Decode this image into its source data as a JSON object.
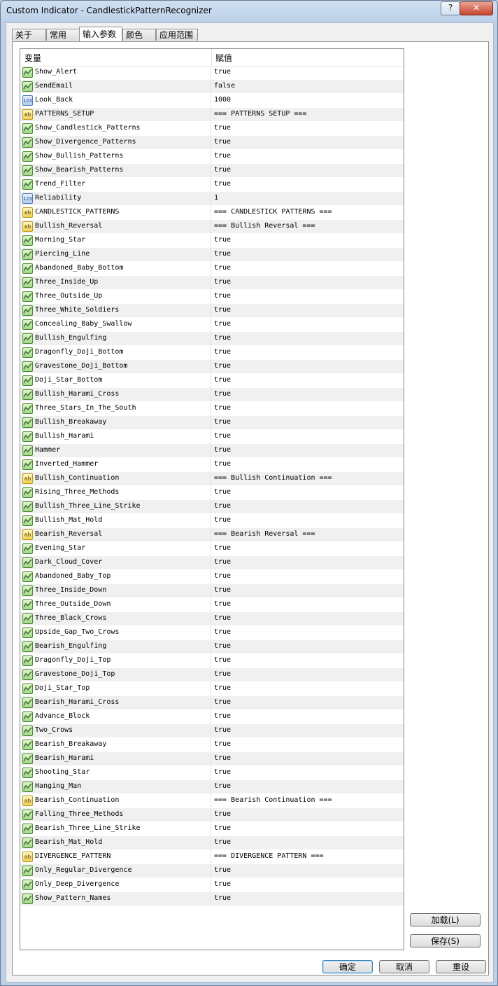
{
  "window": {
    "title": "Custom Indicator - CandlestickPatternRecognizer",
    "help_label": "?",
    "close_label": "✕"
  },
  "tabs": [
    "关于",
    "常用",
    "输入参数",
    "颜色",
    "应用范围"
  ],
  "active_tab": "输入参数",
  "table": {
    "header_variable": "变量",
    "header_value": "赋值",
    "rows": [
      {
        "type": "bool",
        "name": "Show_Alert",
        "value": "true"
      },
      {
        "type": "bool",
        "name": "SendEmail",
        "value": "false"
      },
      {
        "type": "int",
        "name": "Look_Back",
        "value": "1000"
      },
      {
        "type": "str",
        "name": "PATTERNS_SETUP",
        "value": "=== PATTERNS SETUP ==="
      },
      {
        "type": "bool",
        "name": "Show_Candlestick_Patterns",
        "value": "true"
      },
      {
        "type": "bool",
        "name": "Show_Divergence_Patterns",
        "value": "true"
      },
      {
        "type": "bool",
        "name": "Show_Bullish_Patterns",
        "value": "true"
      },
      {
        "type": "bool",
        "name": "Show_Bearish_Patterns",
        "value": "true"
      },
      {
        "type": "bool",
        "name": "Trend_Filter",
        "value": "true"
      },
      {
        "type": "int",
        "name": "Reliability",
        "value": "1"
      },
      {
        "type": "str",
        "name": "CANDLESTICK_PATTERNS",
        "value": "=== CANDLESTICK PATTERNS ==="
      },
      {
        "type": "str",
        "name": "Bullish_Reversal",
        "value": "=== Bullish Reversal ==="
      },
      {
        "type": "bool",
        "name": "Morning_Star",
        "value": "true"
      },
      {
        "type": "bool",
        "name": "Piercing_Line",
        "value": "true"
      },
      {
        "type": "bool",
        "name": "Abandoned_Baby_Bottom",
        "value": "true"
      },
      {
        "type": "bool",
        "name": "Three_Inside_Up",
        "value": "true"
      },
      {
        "type": "bool",
        "name": "Three_Outside_Up",
        "value": "true"
      },
      {
        "type": "bool",
        "name": "Three_White_Soldiers",
        "value": "true"
      },
      {
        "type": "bool",
        "name": "Concealing_Baby_Swallow",
        "value": "true"
      },
      {
        "type": "bool",
        "name": "Bullish_Engulfing",
        "value": "true"
      },
      {
        "type": "bool",
        "name": "Dragonfly_Doji_Bottom",
        "value": "true"
      },
      {
        "type": "bool",
        "name": "Gravestone_Doji_Bottom",
        "value": "true"
      },
      {
        "type": "bool",
        "name": "Doji_Star_Bottom",
        "value": "true"
      },
      {
        "type": "bool",
        "name": "Bullish_Harami_Cross",
        "value": "true"
      },
      {
        "type": "bool",
        "name": "Three_Stars_In_The_South",
        "value": "true"
      },
      {
        "type": "bool",
        "name": "Bullish_Breakaway",
        "value": "true"
      },
      {
        "type": "bool",
        "name": "Bullish_Harami",
        "value": "true"
      },
      {
        "type": "bool",
        "name": "Hammer",
        "value": "true"
      },
      {
        "type": "bool",
        "name": "Inverted_Hammer",
        "value": "true"
      },
      {
        "type": "str",
        "name": "Bullish_Continuation",
        "value": "=== Bullish Continuation ==="
      },
      {
        "type": "bool",
        "name": "Rising_Three_Methods",
        "value": "true"
      },
      {
        "type": "bool",
        "name": "Bullish_Three_Line_Strike",
        "value": "true"
      },
      {
        "type": "bool",
        "name": "Bullish_Mat_Hold",
        "value": "true"
      },
      {
        "type": "str",
        "name": "Bearish_Reversal",
        "value": "=== Bearish Reversal ==="
      },
      {
        "type": "bool",
        "name": "Evening_Star",
        "value": "true"
      },
      {
        "type": "bool",
        "name": "Dark_Cloud_Cover",
        "value": "true"
      },
      {
        "type": "bool",
        "name": "Abandoned_Baby_Top",
        "value": "true"
      },
      {
        "type": "bool",
        "name": "Three_Inside_Down",
        "value": "true"
      },
      {
        "type": "bool",
        "name": "Three_Outside_Down",
        "value": "true"
      },
      {
        "type": "bool",
        "name": "Three_Black_Crows",
        "value": "true"
      },
      {
        "type": "bool",
        "name": "Upside_Gap_Two_Crows",
        "value": "true"
      },
      {
        "type": "bool",
        "name": "Bearish_Engulfing",
        "value": "true"
      },
      {
        "type": "bool",
        "name": "Dragonfly_Doji_Top",
        "value": "true"
      },
      {
        "type": "bool",
        "name": "Gravestone_Doji_Top",
        "value": "true"
      },
      {
        "type": "bool",
        "name": "Doji_Star_Top",
        "value": "true"
      },
      {
        "type": "bool",
        "name": "Bearish_Harami_Cross",
        "value": "true"
      },
      {
        "type": "bool",
        "name": "Advance_Block",
        "value": "true"
      },
      {
        "type": "bool",
        "name": "Two_Crows",
        "value": "true"
      },
      {
        "type": "bool",
        "name": "Bearish_Breakaway",
        "value": "true"
      },
      {
        "type": "bool",
        "name": "Bearish_Harami",
        "value": "true"
      },
      {
        "type": "bool",
        "name": "Shooting_Star",
        "value": "true"
      },
      {
        "type": "bool",
        "name": "Hanging_Man",
        "value": "true"
      },
      {
        "type": "str",
        "name": "Bearish_Continuation",
        "value": "=== Bearish Continuation ==="
      },
      {
        "type": "bool",
        "name": "Falling_Three_Methods",
        "value": "true"
      },
      {
        "type": "bool",
        "name": "Bearish_Three_Line_Strike",
        "value": "true"
      },
      {
        "type": "bool",
        "name": "Bearish_Mat_Hold",
        "value": "true"
      },
      {
        "type": "str",
        "name": "DIVERGENCE_PATTERN",
        "value": "=== DIVERGENCE PATTERN ==="
      },
      {
        "type": "bool",
        "name": "Only_Regular_Divergence",
        "value": "true"
      },
      {
        "type": "bool",
        "name": "Only_Deep_Divergence",
        "value": "true"
      },
      {
        "type": "bool",
        "name": "Show_Pattern_Names",
        "value": "true"
      }
    ]
  },
  "icons": {
    "bool": "boolean-param-icon",
    "int": "integer-param-icon",
    "str": "string-param-icon"
  },
  "icon_glyphs": {
    "int": "123",
    "str": "ab"
  },
  "buttons": {
    "load": "加载(L)",
    "save": "保存(S)",
    "ok": "确定",
    "cancel": "取消",
    "reset": "重设"
  }
}
